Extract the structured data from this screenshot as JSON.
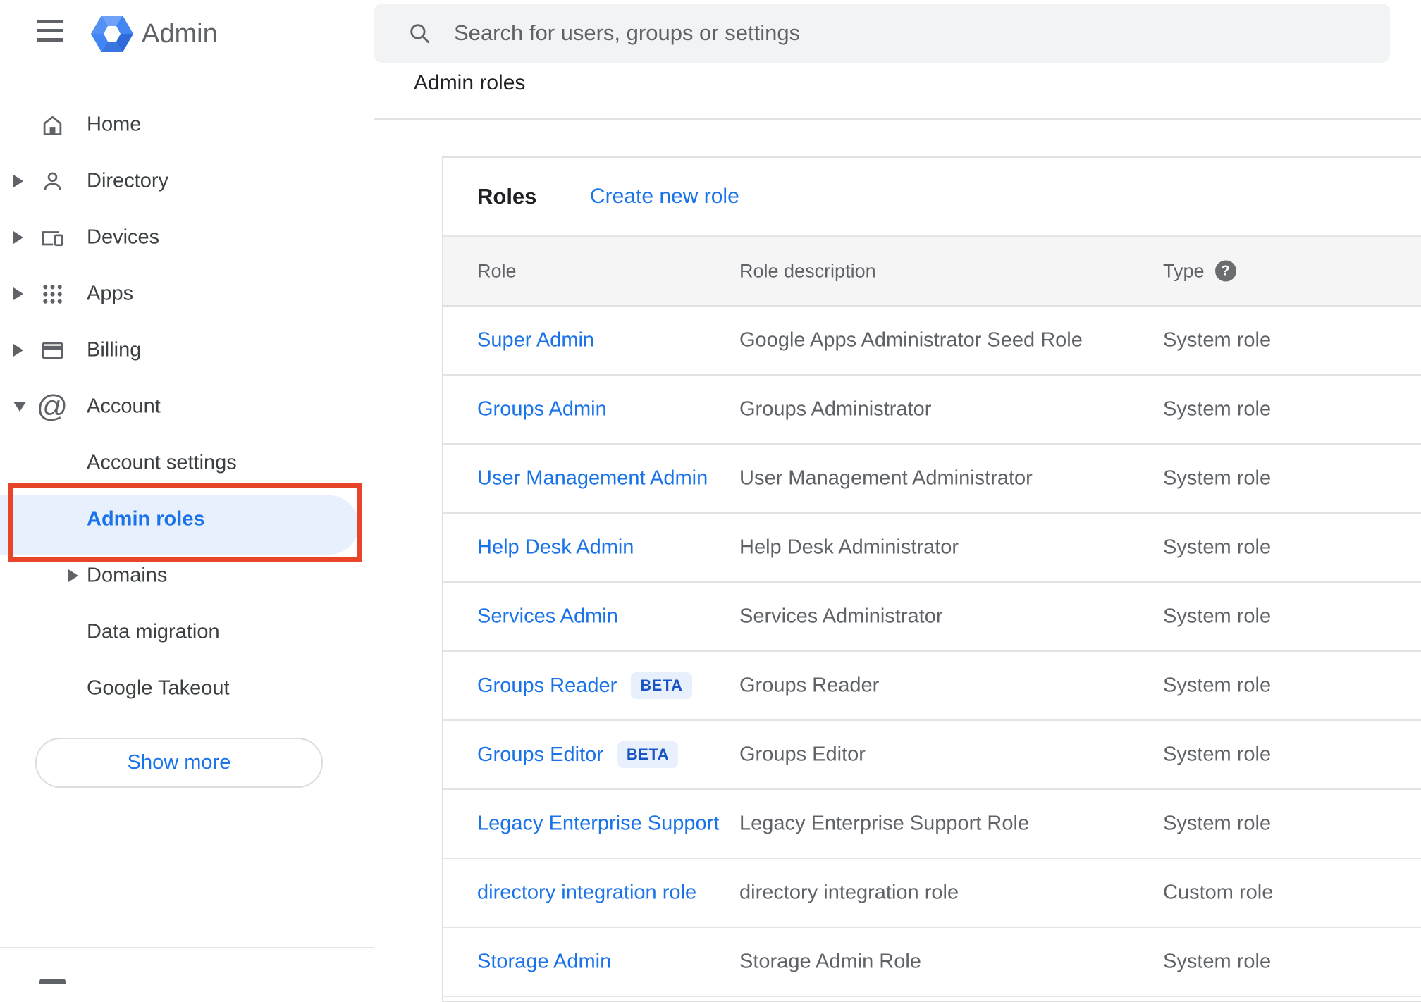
{
  "topbar": {
    "app_name": "Admin",
    "search_placeholder": "Search for users, groups or settings"
  },
  "page": {
    "title": "Admin roles"
  },
  "sidebar": {
    "items": [
      {
        "label": "Home",
        "icon": "home",
        "expander": null,
        "sub": false,
        "active": false
      },
      {
        "label": "Directory",
        "icon": "person",
        "expander": "right",
        "sub": false,
        "active": false
      },
      {
        "label": "Devices",
        "icon": "devices",
        "expander": "right",
        "sub": false,
        "active": false
      },
      {
        "label": "Apps",
        "icon": "apps",
        "expander": "right",
        "sub": false,
        "active": false
      },
      {
        "label": "Billing",
        "icon": "billing",
        "expander": "right",
        "sub": false,
        "active": false
      },
      {
        "label": "Account",
        "icon": "at",
        "expander": "down",
        "sub": false,
        "active": false
      },
      {
        "label": "Account settings",
        "icon": null,
        "expander": null,
        "sub": true,
        "active": false
      },
      {
        "label": "Admin roles",
        "icon": null,
        "expander": null,
        "sub": true,
        "active": true
      },
      {
        "label": "Domains",
        "icon": null,
        "expander": "right",
        "sub": true,
        "active": false
      },
      {
        "label": "Data migration",
        "icon": null,
        "expander": null,
        "sub": true,
        "active": false
      },
      {
        "label": "Google Takeout",
        "icon": null,
        "expander": null,
        "sub": true,
        "active": false
      }
    ],
    "show_more_label": "Show more"
  },
  "annotation": {
    "type": "red-highlight-box",
    "target": "Admin roles",
    "color": "#e8442a"
  },
  "roles_card": {
    "title": "Roles",
    "create_link": "Create new role",
    "columns": [
      "Role",
      "Role description",
      "Type"
    ],
    "type_help_icon": "question-mark",
    "rows": [
      {
        "role": "Super Admin",
        "badge": null,
        "description": "Google Apps Administrator Seed Role",
        "type": "System role"
      },
      {
        "role": "Groups Admin",
        "badge": null,
        "description": "Groups Administrator",
        "type": "System role"
      },
      {
        "role": "User Management Admin",
        "badge": null,
        "description": "User Management Administrator",
        "type": "System role"
      },
      {
        "role": "Help Desk Admin",
        "badge": null,
        "description": "Help Desk Administrator",
        "type": "System role"
      },
      {
        "role": "Services Admin",
        "badge": null,
        "description": "Services Administrator",
        "type": "System role"
      },
      {
        "role": "Groups Reader",
        "badge": "BETA",
        "description": "Groups Reader",
        "type": "System role"
      },
      {
        "role": "Groups Editor",
        "badge": "BETA",
        "description": "Groups Editor",
        "type": "System role"
      },
      {
        "role": "Legacy Enterprise Support",
        "badge": null,
        "description": "Legacy Enterprise Support Role",
        "type": "System role"
      },
      {
        "role": "directory integration role",
        "badge": null,
        "description": "directory integration role",
        "type": "Custom role"
      },
      {
        "role": "Storage Admin",
        "badge": null,
        "description": "Storage Admin Role",
        "type": "System role"
      }
    ]
  },
  "colors": {
    "accent": "#1a73e8",
    "active_item_bg": "#e8f0fe",
    "badge_bg": "#e8f0fe",
    "annotation_red": "#e8442a",
    "thead_bg": "#f5f5f5"
  }
}
